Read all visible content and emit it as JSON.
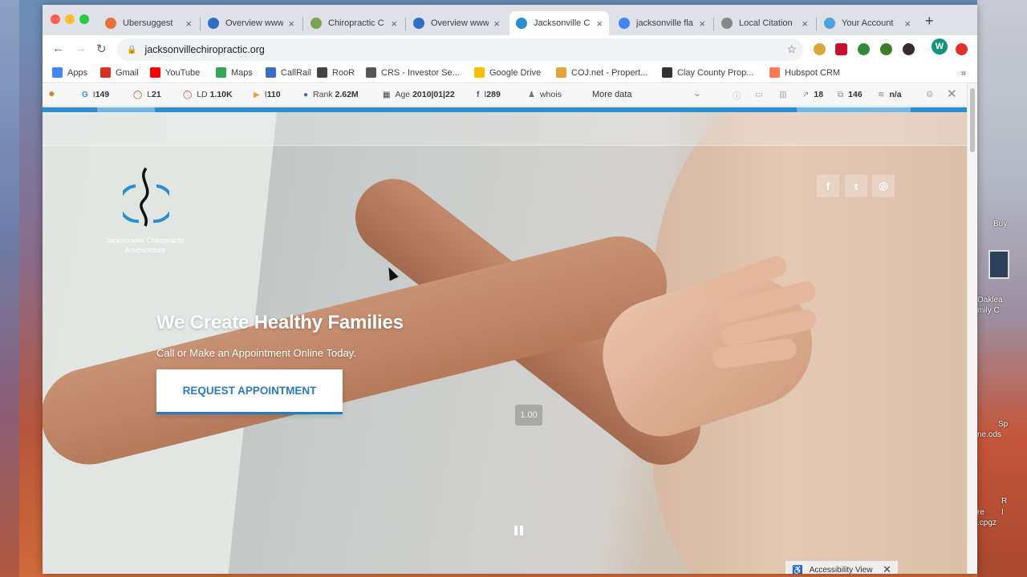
{
  "desktop": {
    "right_labels": [
      "Buy",
      "Oaklea",
      "mily C",
      "Sp",
      "ne.ods",
      "re",
      "R",
      "I",
      ".cpgz"
    ]
  },
  "tabs": [
    {
      "title": "Ubersuggest",
      "favicon": "ubersuggest-icon",
      "color": "#e8713a",
      "active": false
    },
    {
      "title": "Overview www",
      "favicon": "semrush-icon",
      "color": "#2f6fc2",
      "active": false
    },
    {
      "title": "Chiropractic C",
      "favicon": "chiropractic-icon",
      "color": "#7aa356",
      "active": false
    },
    {
      "title": "Overview www",
      "favicon": "semrush-icon",
      "color": "#2f6fc2",
      "active": false
    },
    {
      "title": "Jacksonville C",
      "favicon": "site-icon",
      "color": "#2b8fcf",
      "active": true
    },
    {
      "title": "jacksonville fla",
      "favicon": "google-icon",
      "color": "#4285f4",
      "active": false
    },
    {
      "title": "Local Citation",
      "favicon": "citation-icon",
      "color": "#888888",
      "active": false
    },
    {
      "title": "Your Account",
      "favicon": "account-icon",
      "color": "#4aa3df",
      "active": false
    }
  ],
  "toolbar": {
    "url": "jacksonvillechiropractic.org",
    "profile_initial": "W"
  },
  "bookmarks": [
    {
      "label": "Apps",
      "icon": "apps-grid-icon",
      "color": "#4285f4"
    },
    {
      "label": "Gmail",
      "icon": "gmail-icon",
      "color": "#d93025"
    },
    {
      "label": "YouTube",
      "icon": "youtube-icon",
      "color": "#ff0000"
    },
    {
      "label": "Maps",
      "icon": "maps-pin-icon",
      "color": "#34a853"
    },
    {
      "label": "CallRail",
      "icon": "callrail-icon",
      "color": "#3b6cc7"
    },
    {
      "label": "RooR",
      "icon": "roor-icon",
      "color": "#444444"
    },
    {
      "label": "CRS - Investor Se...",
      "icon": "crs-icon",
      "color": "#555555"
    },
    {
      "label": "Google Drive",
      "icon": "drive-icon",
      "color": "#fbbc04"
    },
    {
      "label": "COJ.net - Propert...",
      "icon": "coj-icon",
      "color": "#e8a33a"
    },
    {
      "label": "Clay County Prop...",
      "icon": "bank-icon",
      "color": "#333333"
    },
    {
      "label": "Hubspot CRM",
      "icon": "hubspot-icon",
      "color": "#ff7a59"
    }
  ],
  "seo": {
    "g_value": "149",
    "l_value": "21",
    "ld_label": "LD",
    "ld_value": "1.10K",
    "i_value": "110",
    "rank_label": "Rank",
    "rank_value": "2.62M",
    "age_label": "Age",
    "age_value": "2010|01|22",
    "fb_value": "289",
    "whois_label": "whois",
    "more_label": "More data",
    "links_out": "18",
    "pages": "146",
    "na": "n/a"
  },
  "hero": {
    "logo_text": "Jacksonville Chiropractic Acupuncture",
    "title": "We Create Healthy Families",
    "subtitle": "Call or Make an Appointment Online Today.",
    "cta_label": "REQUEST APPOINTMENT",
    "speed_label": "1.00",
    "social": [
      {
        "name": "facebook-icon",
        "glyph": "f"
      },
      {
        "name": "twitter-icon",
        "glyph": "t"
      },
      {
        "name": "instagram-icon",
        "glyph": "◎"
      }
    ]
  },
  "a11y": {
    "label": "Accessibility View"
  },
  "colors": {
    "brand_blue": "#2b8fcf",
    "cta_text": "#2b7bbd"
  }
}
